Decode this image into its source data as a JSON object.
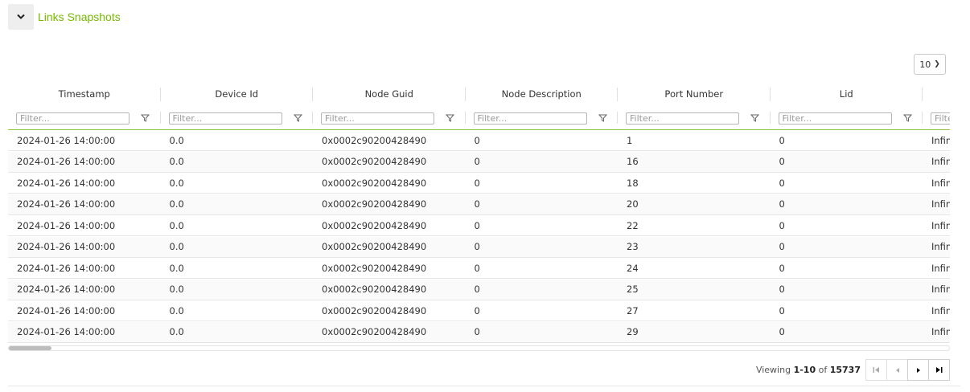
{
  "panel": {
    "title": "Links Snapshots"
  },
  "page_size": {
    "value": "10"
  },
  "columns": [
    "Timestamp",
    "Device Id",
    "Node Guid",
    "Node Description",
    "Port Number",
    "Lid",
    ""
  ],
  "filter_placeholder": "Filter...",
  "rows": [
    [
      "2024-01-26 14:00:00",
      "0.0",
      "0x0002c90200428490",
      "0",
      "1",
      "0",
      "Infin"
    ],
    [
      "2024-01-26 14:00:00",
      "0.0",
      "0x0002c90200428490",
      "0",
      "16",
      "0",
      "Infin"
    ],
    [
      "2024-01-26 14:00:00",
      "0.0",
      "0x0002c90200428490",
      "0",
      "18",
      "0",
      "Infin"
    ],
    [
      "2024-01-26 14:00:00",
      "0.0",
      "0x0002c90200428490",
      "0",
      "20",
      "0",
      "Infin"
    ],
    [
      "2024-01-26 14:00:00",
      "0.0",
      "0x0002c90200428490",
      "0",
      "22",
      "0",
      "Infin"
    ],
    [
      "2024-01-26 14:00:00",
      "0.0",
      "0x0002c90200428490",
      "0",
      "23",
      "0",
      "Infin"
    ],
    [
      "2024-01-26 14:00:00",
      "0.0",
      "0x0002c90200428490",
      "0",
      "24",
      "0",
      "Infin"
    ],
    [
      "2024-01-26 14:00:00",
      "0.0",
      "0x0002c90200428490",
      "0",
      "25",
      "0",
      "Infin"
    ],
    [
      "2024-01-26 14:00:00",
      "0.0",
      "0x0002c90200428490",
      "0",
      "27",
      "0",
      "Infin"
    ],
    [
      "2024-01-26 14:00:00",
      "0.0",
      "0x0002c90200428490",
      "0",
      "29",
      "0",
      "Infin"
    ]
  ],
  "pagination": {
    "viewing_label": "Viewing",
    "range": "1-10",
    "of_label": "of",
    "total": "15737",
    "first_icon": "first-page-icon",
    "prev_icon": "prev-page-icon",
    "next_icon": "next-page-icon",
    "last_icon": "last-page-icon"
  },
  "colors": {
    "accent": "#76b900",
    "filter_line": "#8cc63f"
  }
}
